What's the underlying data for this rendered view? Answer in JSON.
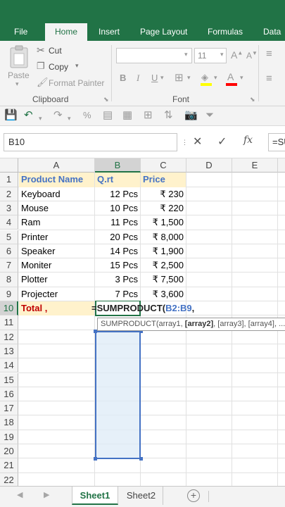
{
  "ribbon_tabs": [
    "File",
    "Home",
    "Insert",
    "Page Layout",
    "Formulas",
    "Data"
  ],
  "active_tab": "Home",
  "clipboard": {
    "paste_label": "Paste",
    "cut_label": "Cut",
    "copy_label": "Copy",
    "format_painter_label": "Format Painter",
    "group_label": "Clipboard"
  },
  "font_group": {
    "font_size": "11",
    "group_label": "Font"
  },
  "formula_bar": {
    "name_box": "B10",
    "formula": "=SU"
  },
  "columns": [
    "A",
    "B",
    "C",
    "D",
    "E"
  ],
  "rows": [
    "1",
    "2",
    "3",
    "4",
    "5",
    "6",
    "7",
    "8",
    "9",
    "10",
    "11",
    "12",
    "13",
    "14",
    "15",
    "16",
    "17",
    "18",
    "19",
    "20",
    "21",
    "22"
  ],
  "table": {
    "headers": [
      "Product Name",
      "Q.rt",
      "Price"
    ],
    "items": [
      {
        "name": "Keyboard",
        "qty": "12 Pcs",
        "price": "₹ 230"
      },
      {
        "name": "Mouse",
        "qty": "10 Pcs",
        "price": "₹ 220"
      },
      {
        "name": "Ram",
        "qty": "11 Pcs",
        "price": "₹ 1,500"
      },
      {
        "name": "Printer",
        "qty": "20 Pcs",
        "price": "₹ 8,000"
      },
      {
        "name": "Speaker",
        "qty": "14 Pcs",
        "price": "₹ 1,900"
      },
      {
        "name": "Moniter",
        "qty": "15 Pcs",
        "price": "₹ 2,500"
      },
      {
        "name": "Plotter",
        "qty": "3 Pcs",
        "price": "₹ 7,500"
      },
      {
        "name": "Projecter",
        "qty": "7 Pcs",
        "price": "₹ 3,600"
      }
    ],
    "total_label": "Total ,",
    "formula_text": "=SUMPRODUCT(",
    "formula_range": "B2:B9",
    "formula_tail": ","
  },
  "tooltip": {
    "before": "SUMPRODUCT(array1, ",
    "bold": "[array2]",
    "after": ", [array3], [array4], ..."
  },
  "sheets": [
    "Sheet1",
    "Sheet2"
  ],
  "active_sheet": "Sheet1",
  "colors": {
    "excel_green": "#217346",
    "header_blue": "#4472c4",
    "header_fill": "#fff2cc",
    "total_red": "#c00000"
  }
}
